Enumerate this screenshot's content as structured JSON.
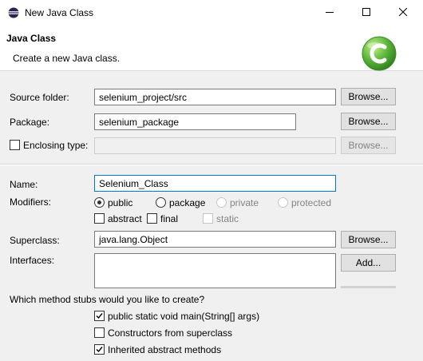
{
  "window": {
    "title": "New Java Class"
  },
  "header": {
    "title": "Java Class",
    "description": "Create a new Java class.",
    "accent_color": "#5ab53a"
  },
  "source_folder": {
    "label": "Source folder:",
    "value": "selenium_project/src",
    "browse_label": "Browse..."
  },
  "package": {
    "label": "Package:",
    "value": "selenium_package",
    "browse_label": "Browse..."
  },
  "enclosing_type": {
    "label": "Enclosing type:",
    "checked": false,
    "value": "",
    "browse_label": "Browse..."
  },
  "name": {
    "label": "Name:",
    "value": "Selenium_Class"
  },
  "modifiers": {
    "label": "Modifiers:",
    "access": [
      {
        "label": "public",
        "selected": true,
        "enabled": true
      },
      {
        "label": "package",
        "selected": false,
        "enabled": true
      },
      {
        "label": "private",
        "selected": false,
        "enabled": false
      },
      {
        "label": "protected",
        "selected": false,
        "enabled": false
      }
    ],
    "flags": [
      {
        "label": "abstract",
        "checked": false,
        "enabled": true
      },
      {
        "label": "final",
        "checked": false,
        "enabled": true
      },
      {
        "label": "static",
        "checked": false,
        "enabled": false
      }
    ]
  },
  "superclass": {
    "label": "Superclass:",
    "value": "java.lang.Object",
    "browse_label": "Browse..."
  },
  "interfaces": {
    "label": "Interfaces:",
    "add_label": "Add..."
  },
  "stubs": {
    "question": "Which method stubs would you like to create?",
    "options": [
      {
        "label": "public static void main(String[] args)",
        "checked": true
      },
      {
        "label": "Constructors from superclass",
        "checked": false
      },
      {
        "label": "Inherited abstract methods",
        "checked": true
      }
    ]
  }
}
